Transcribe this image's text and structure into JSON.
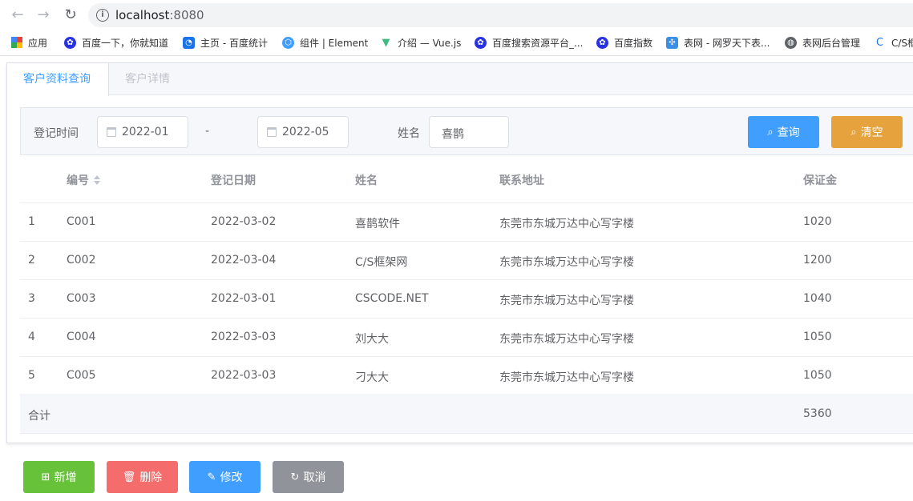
{
  "browser": {
    "url": "localhost:8080",
    "url_host": "localhost",
    "url_port": ":8080",
    "bookmarks": [
      {
        "label": "应用",
        "icon": "apps-grid-icon",
        "color": "#ea4335"
      },
      {
        "label": "百度一下，你就知道",
        "icon": "baidu-paw-icon",
        "color": "#2932e1"
      },
      {
        "label": "主页 - 百度统计",
        "icon": "baidu-tongji-icon",
        "color": "#1a73e8"
      },
      {
        "label": "组件 | Element",
        "icon": "element-icon",
        "color": "#409eff"
      },
      {
        "label": "介绍 — Vue.js",
        "icon": "vue-icon",
        "color": "#42b883"
      },
      {
        "label": "百度搜索资源平台_...",
        "icon": "baidu-paw-icon",
        "color": "#2932e1"
      },
      {
        "label": "百度指数",
        "icon": "baidu-paw-icon",
        "color": "#2932e1"
      },
      {
        "label": "表网 - 网罗天下表...",
        "icon": "biaowang-icon",
        "color": "#3a8ee6"
      },
      {
        "label": "表网后台管理",
        "icon": "globe-icon",
        "color": "#5f6368"
      },
      {
        "label": "C/S框",
        "icon": "cs-icon",
        "color": "#1a73e8"
      }
    ]
  },
  "tabs": [
    {
      "label": "客户资料查询",
      "active": true
    },
    {
      "label": "客户详情",
      "active": false
    }
  ],
  "search": {
    "date_label": "登记时间",
    "date_from": "2022-01",
    "date_sep": "-",
    "date_to": "2022-05",
    "name_label": "姓名",
    "name_value": "喜鹊",
    "query_label": "查询",
    "clear_label": "清空"
  },
  "table": {
    "columns": [
      "",
      "编号",
      "登记日期",
      "姓名",
      "联系地址",
      "保证金"
    ],
    "rows": [
      [
        "1",
        "C001",
        "2022-03-02",
        "喜鹊软件",
        "东莞市东城万达中心写字楼",
        "1020"
      ],
      [
        "2",
        "C002",
        "2022-03-04",
        "C/S框架网",
        "东莞市东城万达中心写字楼",
        "1200"
      ],
      [
        "3",
        "C003",
        "2022-03-01",
        "CSCODE.NET",
        "东莞市东城万达中心写字楼",
        "1040"
      ],
      [
        "4",
        "C004",
        "2022-03-03",
        "刘大大",
        "东莞市东城万达中心写字楼",
        "1050"
      ],
      [
        "5",
        "C005",
        "2022-03-03",
        "刁大大",
        "东莞市东城万达中心写字楼",
        "1050"
      ]
    ],
    "summary_label": "合计",
    "summary_total": "5360"
  },
  "actions": {
    "add_label": "新增",
    "delete_label": "删除",
    "edit_label": "修改",
    "cancel_label": "取消"
  },
  "colors": {
    "primary": "#409eff",
    "success": "#67c23a",
    "danger": "#f56c6c",
    "warning": "#e6a23c",
    "info": "#909399"
  }
}
